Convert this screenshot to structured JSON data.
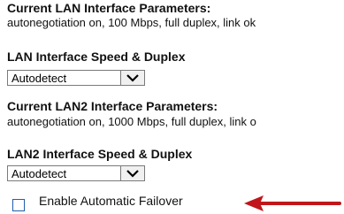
{
  "lan": {
    "params_heading": "Current LAN Interface Parameters:",
    "params_value": "autonegotiation on, 100 Mbps, full duplex, link ok",
    "speed_heading": "LAN Interface Speed & Duplex",
    "speed_selected": "Autodetect"
  },
  "lan2": {
    "params_heading": "Current LAN2 Interface Parameters:",
    "params_value": "autonegotiation on, 1000 Mbps, full duplex, link o",
    "speed_heading": "LAN2 Interface Speed & Duplex",
    "speed_selected": "Autodetect"
  },
  "failover": {
    "label": "Enable Automatic Failover",
    "checked": false
  },
  "colors": {
    "checkbox_border": "#1f5fa8",
    "arrow": "#c0161b"
  },
  "icons": {
    "dropdown": "chevron-down-icon",
    "annotation": "arrow-left-icon"
  }
}
